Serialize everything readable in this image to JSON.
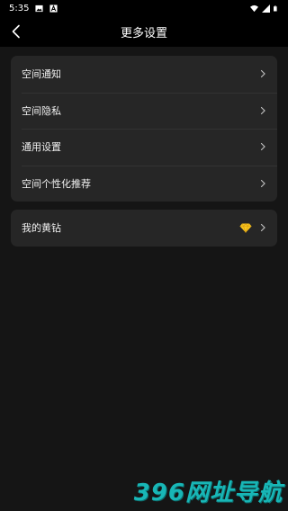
{
  "status_bar": {
    "time": "5:35",
    "icons": [
      "image-icon",
      "a-icon",
      "wifi-icon",
      "signal-icon",
      "battery-icon"
    ]
  },
  "nav": {
    "title": "更多设置",
    "back_icon": "chevron-left-icon"
  },
  "settings_group_1": {
    "items": [
      {
        "label": "空间通知"
      },
      {
        "label": "空间隐私"
      },
      {
        "label": "通用设置"
      },
      {
        "label": "空间个性化推荐"
      }
    ]
  },
  "settings_group_2": {
    "items": [
      {
        "label": "我的黄钻",
        "icon": "yellow-diamond-icon"
      }
    ]
  },
  "watermark": {
    "text": "396网址导航"
  },
  "colors": {
    "background": "#151515",
    "card": "#262626",
    "bar": "#000000",
    "diamond": "#f7c51e",
    "watermark": "#18b6b6"
  }
}
